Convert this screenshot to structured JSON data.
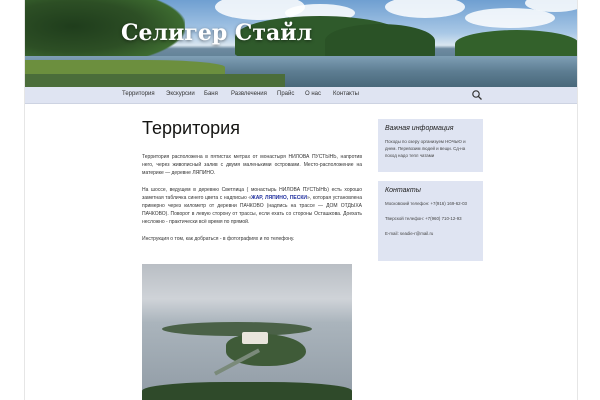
{
  "site": {
    "title": "Селигер Стайл"
  },
  "nav": {
    "items": [
      "Территория",
      "Экскурсии",
      "Баня",
      "Развлечения",
      "Прайс",
      "О нас",
      "Контакты"
    ]
  },
  "article": {
    "title": "Территория",
    "p1": "Территория расположена в пятистах метрах от монастыря НИЛОВА ПУСТЫНЬ, напротив него, через живописный залив с двумя маленькими островами. Место-расположение на материке — деревне ЛЯПИНО.",
    "p2_before": "На шоссе, ведущем в деревню Светлица ( монастырь НИЛОВА ПУСТЫНЬ) есть хорошо заметная табличка синего цвета с надписью «",
    "p2_highlight": "ЖАР, ЛЯПИНО, ПЕСКИ",
    "p2_after": "», которая установлена примерно через километр от деревни ПАЧКОВО (надпись на трассе — ДОМ ОТДЫХА ПАЧКОВО). Поворот в левую сторону от трассы, если ехать со стороны Осташкова. Доехать несложно - практически всё время по прямой.",
    "p3": "Инструкция о том, как добраться - в фотографиях и по телефону."
  },
  "sidebar": {
    "info": {
      "title": "Важная информация",
      "text": "Походы по озеру организуем НОЧЬЮ и днем. Перевозим людей и вещи. Сд-на поход надо тепл чатами"
    },
    "contacts": {
      "title": "Контакты",
      "phone_moscow": "Московский телефон: +7(916) 169-62-03",
      "phone_tver": "Тверской телефон: +7(960) 710-12-93",
      "email": "E-mail: seadie-r@mail.ru"
    }
  },
  "colors": {
    "nav_bg": "#dfe4f2",
    "highlight": "#1f2e9e"
  },
  "icons": {
    "search": "search-icon"
  }
}
